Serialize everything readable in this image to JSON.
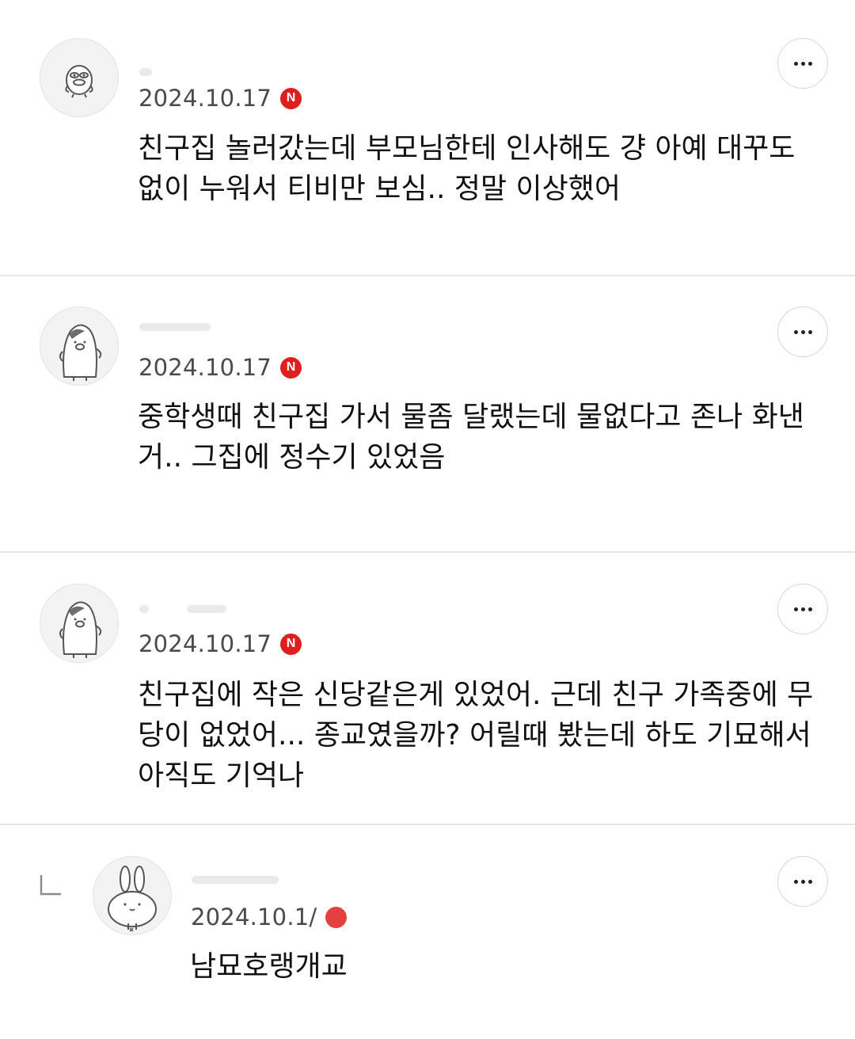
{
  "comments": [
    {
      "date": "2024.10.17",
      "badge": "N",
      "text": "친구집 놀러갔는데 부모님한테 인사해도 걍 아예 대꾸도\n없이 누워서 티비만 보심.. 정말 이상했어",
      "avatar": "duck-character-icon",
      "more": "more-options-icon"
    },
    {
      "date": "2024.10.17",
      "badge": "N",
      "text": "중학생때 친구집 가서 물좀 달랬는데 물없다고 존나 화낸\n거.. 그집에 정수기 있었음",
      "avatar": "penguin-pig-character-icon",
      "more": "more-options-icon"
    },
    {
      "date": "2024.10.17",
      "badge": "N",
      "text": "친구집에 작은 신당같은게 있었어. 근데 친구 가족중에 무\n당이 없었어... 종교였을까? 어릴때 봤는데 하도 기묘해서\n아직도 기억나",
      "avatar": "penguin-pig-character-icon",
      "more": "more-options-icon"
    },
    {
      "date": "2024.10.1/",
      "badge": "",
      "text": "남묘호랭개교",
      "avatar": "bunny-character-icon",
      "reply_icon": "reply-arrow-icon",
      "more": "more-options-icon"
    }
  ],
  "colors": {
    "badge": "#e01e1e",
    "divider": "#e6e6e6",
    "date": "#4a4a4a",
    "text": "#111111"
  }
}
